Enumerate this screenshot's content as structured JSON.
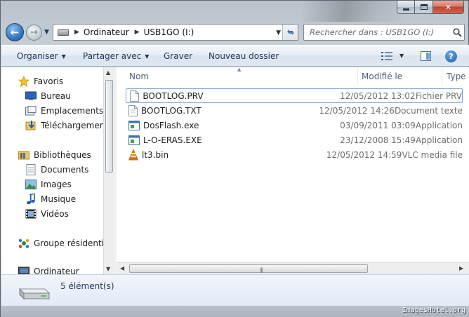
{
  "nav": {
    "breadcrumb": [
      "Ordinateur",
      "USB1GO (I:)"
    ],
    "search_placeholder": "Rechercher dans : USB1GO (I:)"
  },
  "toolbar": {
    "organize": "Organiser",
    "share": "Partager avec",
    "burn": "Graver",
    "new_folder": "Nouveau dossier"
  },
  "sidebar": {
    "favorites": "Favoris",
    "desktop": "Bureau",
    "recent_places": "Emplacements récents",
    "downloads": "Téléchargements",
    "libraries": "Bibliothèques",
    "documents": "Documents",
    "images": "Images",
    "music": "Musique",
    "videos": "Vidéos",
    "homegroup": "Groupe résidentiel",
    "computer": "Ordinateur"
  },
  "columns": {
    "name": "Nom",
    "modified": "Modifié le",
    "type": "Type"
  },
  "files": [
    {
      "name": "BOOTLOG.PRV",
      "modified": "12/05/2012 13:02",
      "type": "Fichier PRV",
      "icon": "blank-file-icon"
    },
    {
      "name": "BOOTLOG.TXT",
      "modified": "12/05/2012 14:26",
      "type": "Document texte",
      "icon": "text-file-icon"
    },
    {
      "name": "DosFlash.exe",
      "modified": "03/09/2011 03:09",
      "type": "Application",
      "icon": "exe-icon"
    },
    {
      "name": "L-O-ERAS.EXE",
      "modified": "23/12/2008 15:49",
      "type": "Application",
      "icon": "exe-icon"
    },
    {
      "name": "lt3.bin",
      "modified": "12/05/2012 14:59",
      "type": "VLC media file",
      "icon": "vlc-icon"
    }
  ],
  "details": {
    "item_count": "5 élément(s)"
  },
  "watermark": "ImagesHotel.org",
  "colors": {
    "accent_blue": "#3a7bc8",
    "close_red": "#c0442c",
    "command_text": "#1e395b"
  }
}
